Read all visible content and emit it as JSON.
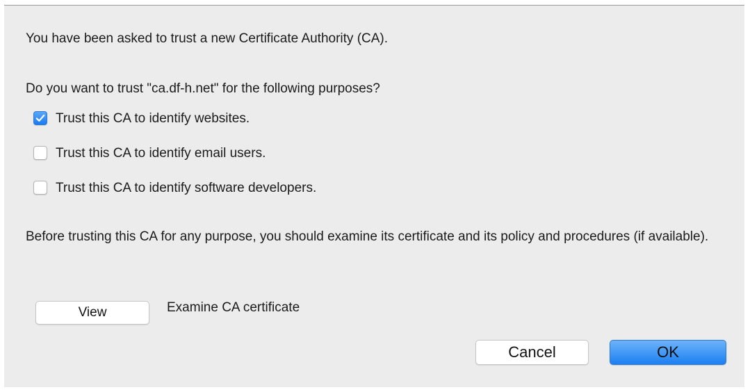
{
  "dialog": {
    "intro": "You have been asked to trust a new Certificate Authority (CA).",
    "question": "Do you want to trust \"ca.df-h.net\" for the following purposes?",
    "purposes": [
      {
        "label": "Trust this CA to identify websites.",
        "checked": true
      },
      {
        "label": "Trust this CA to identify email users.",
        "checked": false
      },
      {
        "label": "Trust this CA to identify software developers.",
        "checked": false
      }
    ],
    "advice": "Before trusting this CA for any purpose, you should examine its certificate and its policy and procedures (if available).",
    "view_button": "View",
    "examine_label": "Examine CA certificate",
    "cancel_button": "Cancel",
    "ok_button": "OK"
  },
  "colors": {
    "dialog_background": "#ececec",
    "accent_blue": "#1a7cf0"
  },
  "icons": {
    "checkmark": "checkmark-icon"
  }
}
